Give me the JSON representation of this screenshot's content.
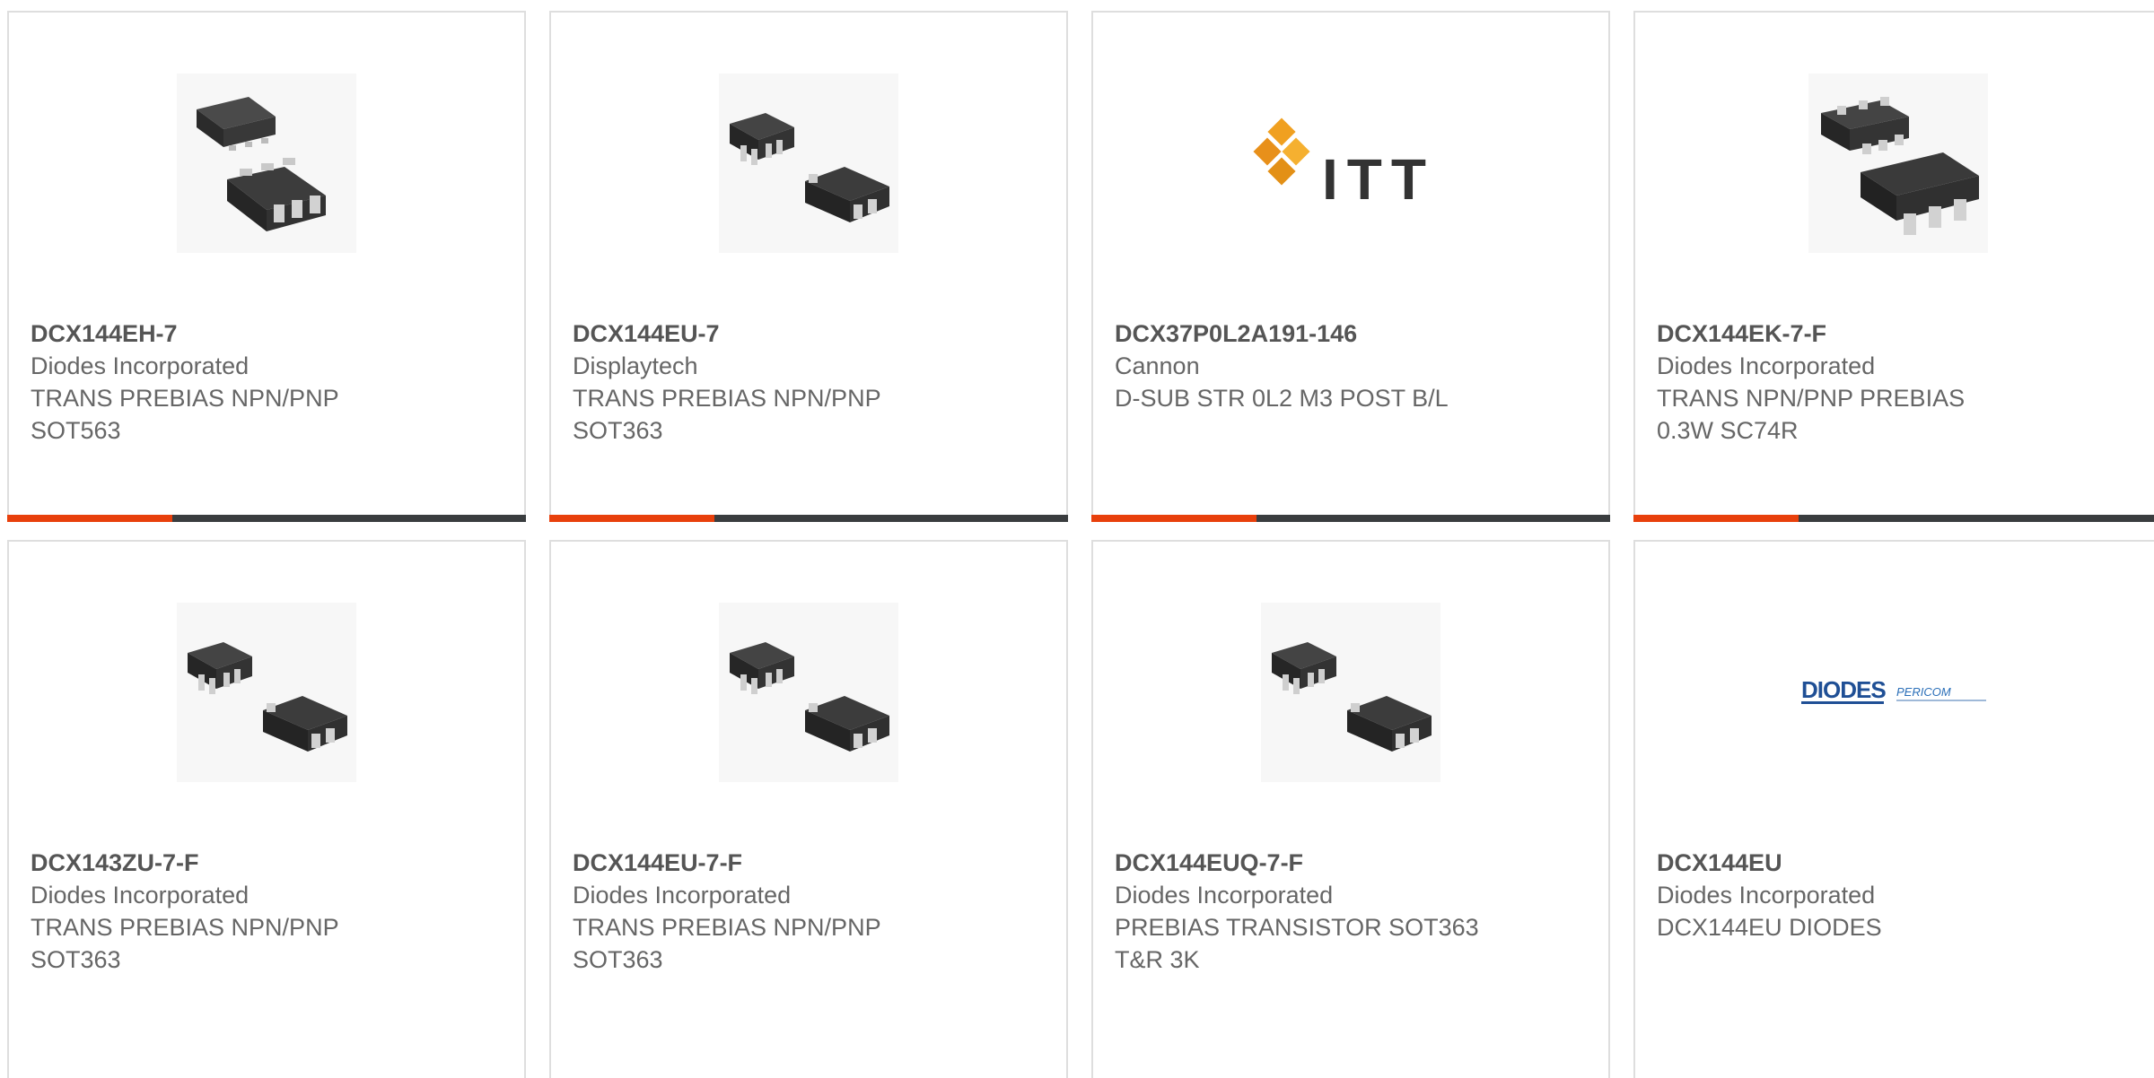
{
  "accent_color": "#e8400c",
  "bar_color": "#3a3d3f",
  "cards": [
    {
      "part_number": "DCX144EH-7",
      "manufacturer": "Diodes Incorporated",
      "description": "TRANS PREBIAS NPN/PNP\nSOT563",
      "image_icon": "sot563-package-icon"
    },
    {
      "part_number": "DCX144EU-7",
      "manufacturer": "Displaytech",
      "description": "TRANS PREBIAS NPN/PNP\nSOT363",
      "image_icon": "sot363-package-icon"
    },
    {
      "part_number": "DCX37P0L2A191-146",
      "manufacturer": "Cannon",
      "description": "D-SUB STR 0L2 M3 POST B/L",
      "image_icon": "itt-logo",
      "logo_text": "ITT"
    },
    {
      "part_number": "DCX144EK-7-F",
      "manufacturer": "Diodes Incorporated",
      "description": "TRANS NPN/PNP PREBIAS\n0.3W SC74R",
      "image_icon": "sc74r-package-icon"
    },
    {
      "part_number": "DCX143ZU-7-F",
      "manufacturer": "Diodes Incorporated",
      "description": "TRANS PREBIAS NPN/PNP\nSOT363",
      "image_icon": "sot363-package-icon"
    },
    {
      "part_number": "DCX144EU-7-F",
      "manufacturer": "Diodes Incorporated",
      "description": "TRANS PREBIAS NPN/PNP\nSOT363",
      "image_icon": "sot363-package-icon"
    },
    {
      "part_number": "DCX144EUQ-7-F",
      "manufacturer": "Diodes Incorporated",
      "description": "PREBIAS TRANSISTOR SOT363\nT&R 3K",
      "image_icon": "sot363-package-icon"
    },
    {
      "part_number": "DCX144EU",
      "manufacturer": "Diodes Incorporated",
      "description": "DCX144EU DIODES",
      "image_icon": "diodes-pericom-logo",
      "logo_text": "DIODES",
      "logo_text_2": "PERICOM"
    }
  ]
}
